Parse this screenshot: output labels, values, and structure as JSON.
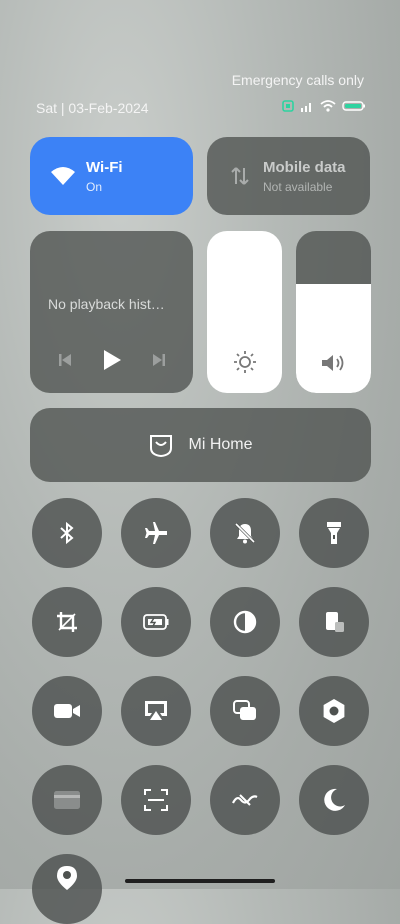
{
  "status": {
    "network_text": "Emergency calls only",
    "date": "Sat | 03-Feb-2024"
  },
  "tiles": {
    "wifi": {
      "title": "Wi-Fi",
      "subtitle": "On"
    },
    "mobile": {
      "title": "Mobile data",
      "subtitle": "Not available"
    }
  },
  "media": {
    "placeholder": "No playback hist…"
  },
  "sliders": {
    "brightness_level": 1.0,
    "volume_level": 0.67
  },
  "mihome": {
    "label": "Mi Home"
  },
  "toggles": [
    {
      "name": "bluetooth-icon"
    },
    {
      "name": "airplane-icon"
    },
    {
      "name": "mute-icon"
    },
    {
      "name": "flashlight-icon"
    },
    {
      "name": "crop-icon"
    },
    {
      "name": "battery-saver-icon"
    },
    {
      "name": "contrast-icon"
    },
    {
      "name": "screen-icon"
    },
    {
      "name": "video-camera-icon"
    },
    {
      "name": "cast-icon"
    },
    {
      "name": "floating-window-icon"
    },
    {
      "name": "hexagon-settings-icon"
    },
    {
      "name": "card-icon"
    },
    {
      "name": "scanner-icon"
    },
    {
      "name": "wave-icon"
    },
    {
      "name": "moon-icon"
    },
    {
      "name": "location-icon"
    }
  ],
  "colors": {
    "wifi_active": "#3c82f6",
    "tile_bg": "#4e5250"
  }
}
